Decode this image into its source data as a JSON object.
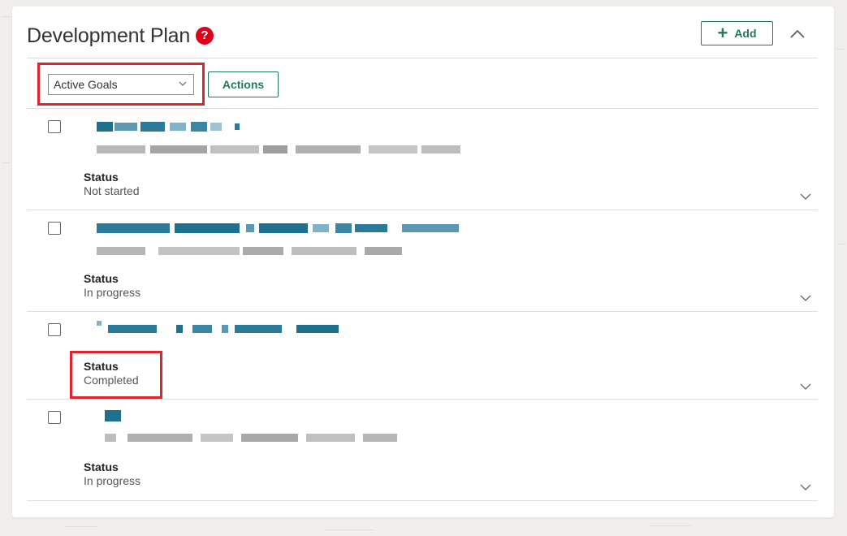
{
  "header": {
    "title": "Development Plan",
    "help_glyph": "?",
    "add_label": "Add"
  },
  "toolbar": {
    "filter_selected": "Active Goals",
    "actions_label": "Actions"
  },
  "goals": [
    {
      "status_label": "Status",
      "status_value": "Not started"
    },
    {
      "status_label": "Status",
      "status_value": "In progress"
    },
    {
      "status_label": "Status",
      "status_value": "Completed"
    },
    {
      "status_label": "Status",
      "status_value": "In progress"
    }
  ],
  "colors": {
    "accent": "#217a5a",
    "help": "#e0001b",
    "highlight": "#e0242d",
    "blurred_title": "#1f6f8f",
    "blurred_text": "#9a9a9a"
  }
}
